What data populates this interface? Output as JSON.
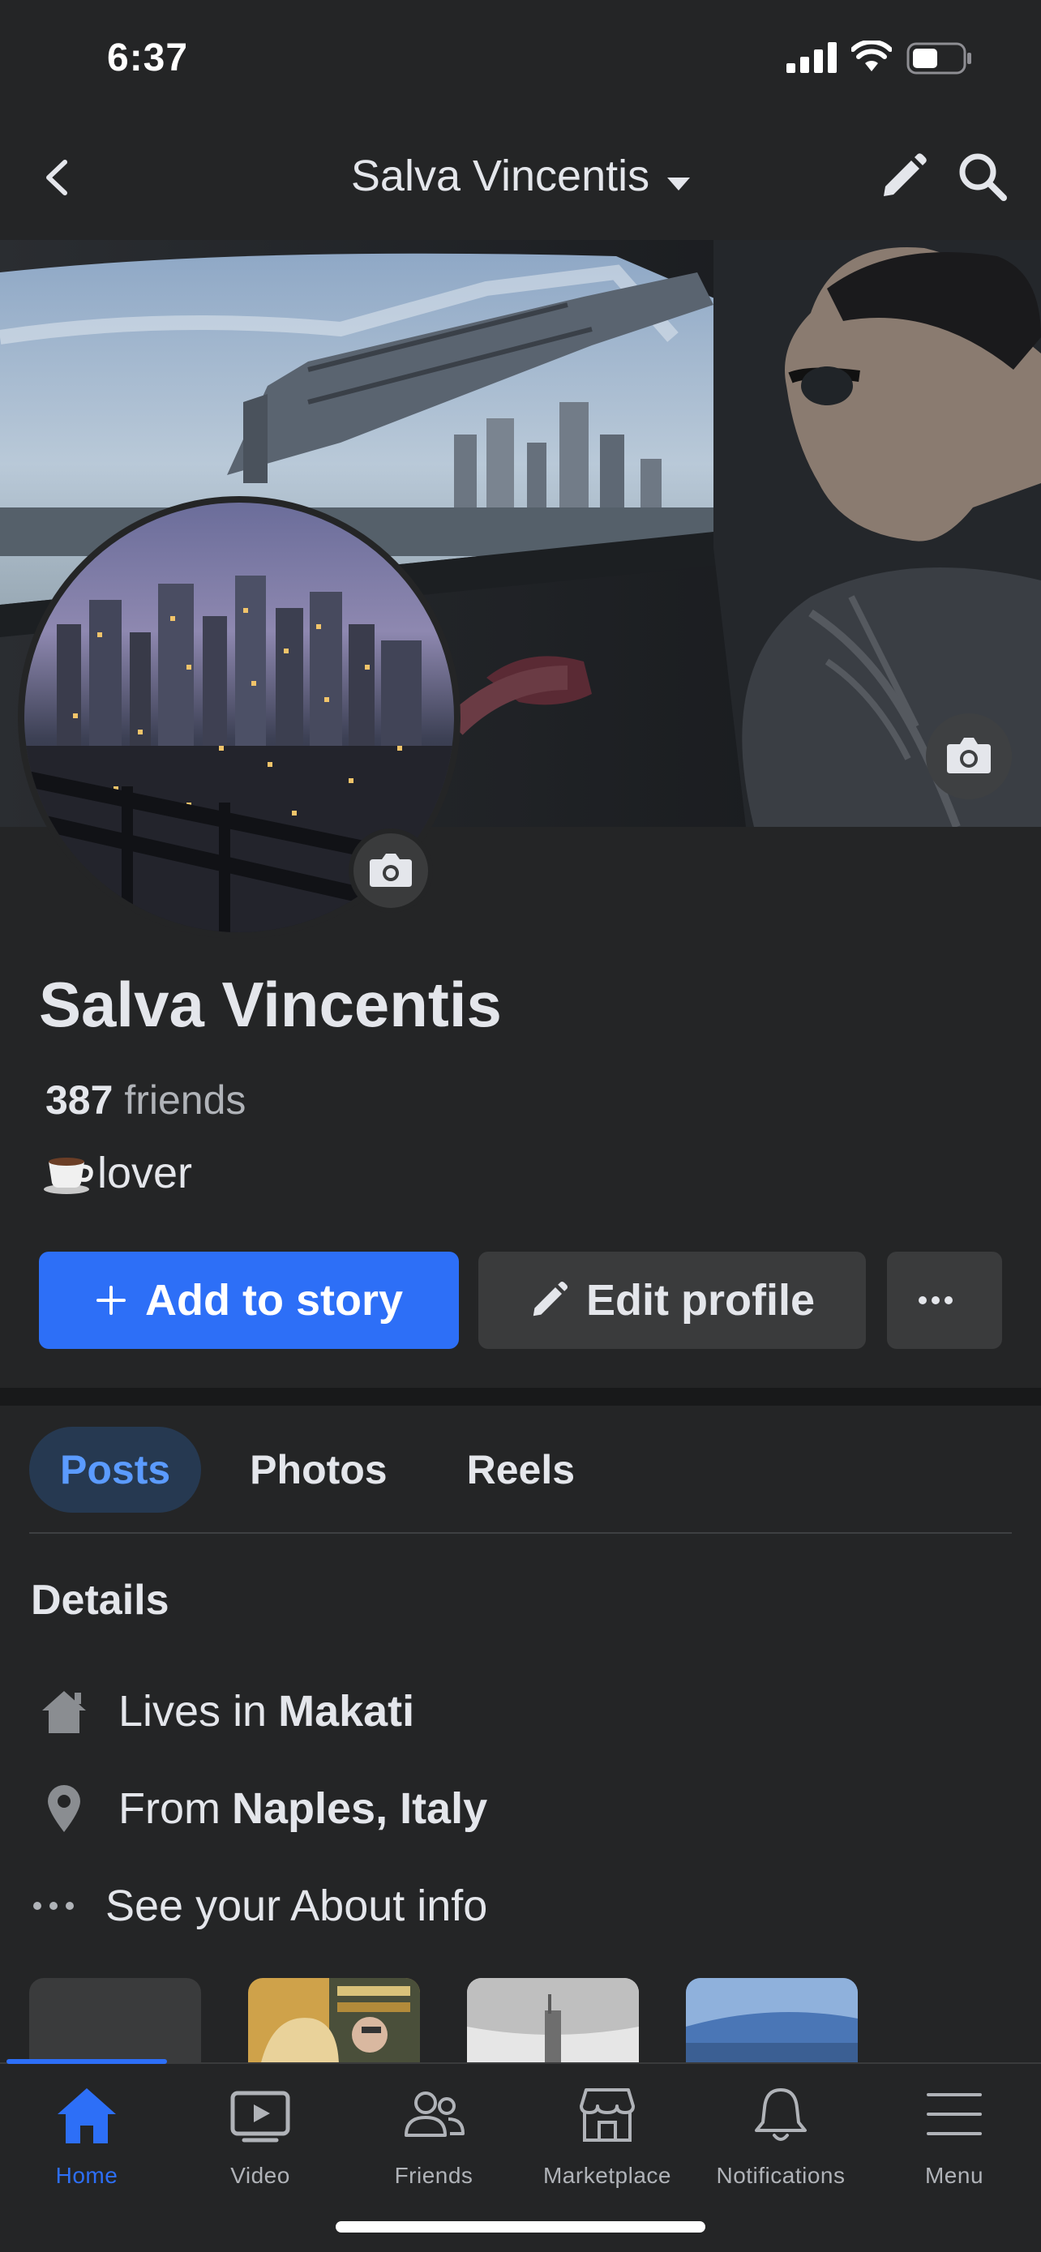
{
  "status": {
    "time": "6:37"
  },
  "nav": {
    "title": "Salva Vincentis",
    "icons": [
      "back-icon",
      "chevron-down-icon",
      "pencil-icon",
      "search-icon"
    ]
  },
  "profile": {
    "name": "Salva Vincentis",
    "friends_count": "387",
    "friends_label": "friends",
    "bio_emoji": "coffee-cup-icon",
    "bio_text": "lover"
  },
  "actions": {
    "add_story": "Add to story",
    "edit_profile": "Edit profile",
    "more": "more-icon"
  },
  "tabs": [
    {
      "label": "Posts",
      "active": true
    },
    {
      "label": "Photos",
      "active": false
    },
    {
      "label": "Reels",
      "active": false
    }
  ],
  "details": {
    "title": "Details",
    "lives_prefix": "Lives in",
    "lives_value": "Makati",
    "from_prefix": "From",
    "from_value": "Naples, Italy",
    "about": "See your About info"
  },
  "bottom_tabs": [
    {
      "label": "Home",
      "icon": "home-icon",
      "active": true
    },
    {
      "label": "Video",
      "icon": "video-icon",
      "active": false
    },
    {
      "label": "Friends",
      "icon": "friends-icon",
      "active": false
    },
    {
      "label": "Marketplace",
      "icon": "marketplace-icon",
      "active": false
    },
    {
      "label": "Notifications",
      "icon": "bell-icon",
      "active": false
    },
    {
      "label": "Menu",
      "icon": "menu-icon",
      "active": false
    }
  ],
  "colors": {
    "accent": "#2d6ff7",
    "background": "#242526",
    "surface": "#3a3b3c",
    "tab_active_bg": "#263951"
  }
}
